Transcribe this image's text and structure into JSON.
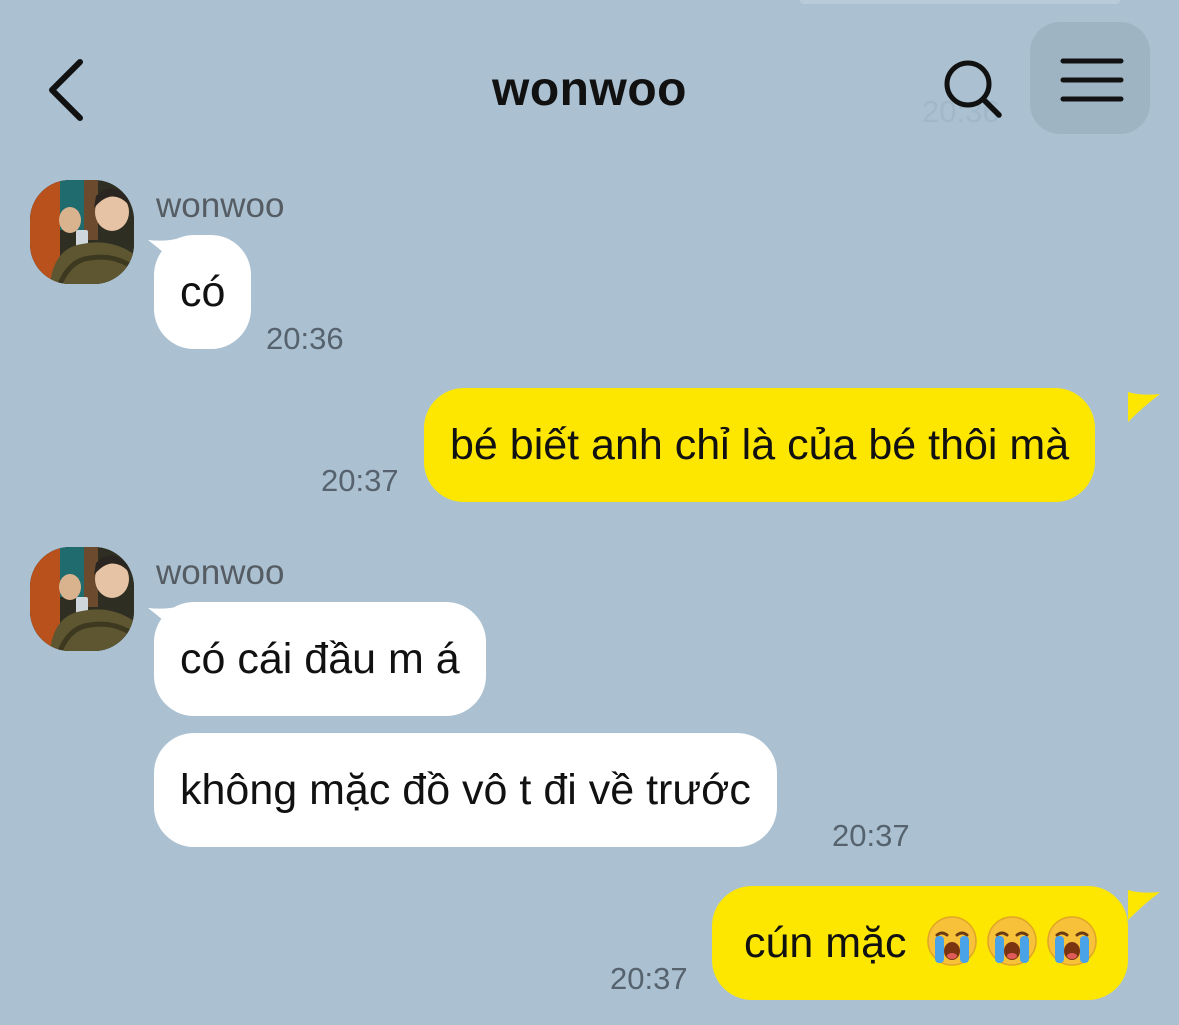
{
  "header": {
    "title": "wonwoo",
    "ghost_time": "20:36"
  },
  "colors": {
    "background": "#abc1d1",
    "incoming_bubble": "#ffffff",
    "outgoing_bubble": "#fde700"
  },
  "icons": {
    "back": "chevron-left-icon",
    "search": "search-icon",
    "menu": "menu-icon",
    "emoji": "loudly-crying-face-emoji"
  },
  "messages": [
    {
      "sender": "wonwoo",
      "text": "có",
      "time": "20:36"
    },
    {
      "sender": "me",
      "text": "bé biết anh chỉ là của bé thôi mà",
      "time": "20:37"
    },
    {
      "sender": "wonwoo",
      "text": "có cái đầu m á"
    },
    {
      "sender": "wonwoo",
      "text": "không mặc đồ vô t đi về trước",
      "time": "20:37"
    },
    {
      "sender": "me",
      "text": "cún mặc",
      "emoji_count": 3,
      "time": "20:37"
    }
  ]
}
